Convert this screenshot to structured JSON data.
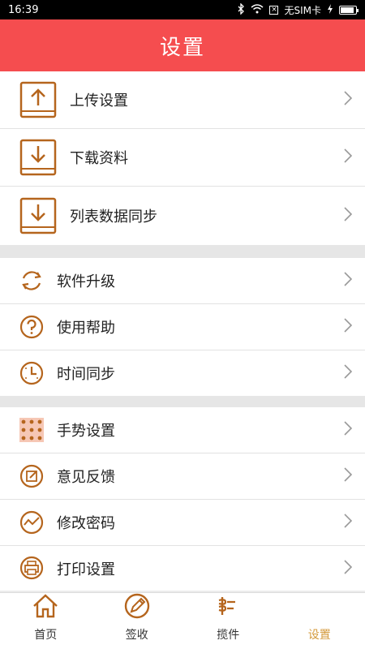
{
  "status": {
    "time": "16:39",
    "carrier": "无SIM卡",
    "battery_level": 0.9
  },
  "header": {
    "title": "设置"
  },
  "menu": {
    "group1": [
      {
        "label": "上传设置",
        "icon": "upload-icon"
      },
      {
        "label": "下载资料",
        "icon": "download-icon"
      },
      {
        "label": "列表数据同步",
        "icon": "list-sync-icon"
      }
    ],
    "group2": [
      {
        "label": "软件升级",
        "icon": "refresh-icon"
      },
      {
        "label": "使用帮助",
        "icon": "help-icon"
      },
      {
        "label": "时间同步",
        "icon": "clock-icon"
      }
    ],
    "group3": [
      {
        "label": "手势设置",
        "icon": "gesture-grid-icon"
      },
      {
        "label": "意见反馈",
        "icon": "feedback-edit-icon"
      },
      {
        "label": "修改密码",
        "icon": "password-wave-icon"
      },
      {
        "label": "打印设置",
        "icon": "printer-icon"
      }
    ]
  },
  "tabs": [
    {
      "label": "首页",
      "icon": "home-icon"
    },
    {
      "label": "签收",
      "icon": "sign-pen-icon"
    },
    {
      "label": "揽件",
      "icon": "pickup-icon"
    },
    {
      "label": "设置",
      "icon": "settings-icon",
      "active": true
    }
  ],
  "colors": {
    "accent": "#f54d4f",
    "icon": "#b5651d",
    "active_tab": "#d49a3c"
  }
}
